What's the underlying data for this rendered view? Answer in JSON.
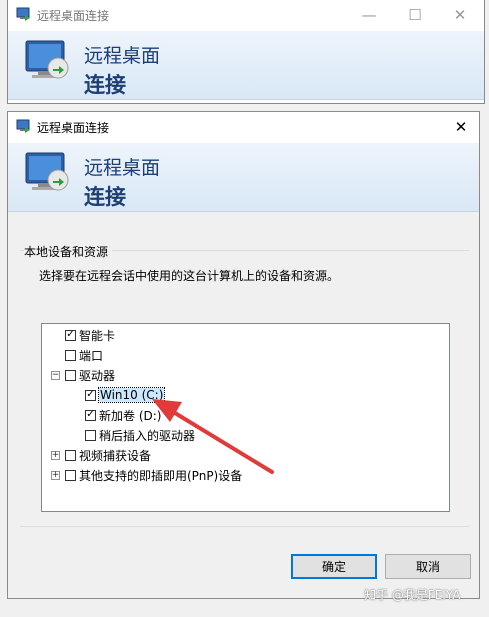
{
  "back_window": {
    "title": "远程桌面连接",
    "banner_line1": "远程桌面",
    "banner_line2": "连接",
    "minimize": "—",
    "maximize": "☐",
    "close": "✕"
  },
  "dialog": {
    "title": "远程桌面连接",
    "close": "✕",
    "banner_line1": "远程桌面",
    "banner_line2": "连接",
    "group_label": "本地设备和资源",
    "description": "选择要在远程会话中使用的这台计算机上的设备和资源。",
    "tree": {
      "smart_card": {
        "label": "智能卡",
        "checked": true
      },
      "ports": {
        "label": "端口",
        "checked": false
      },
      "drives": {
        "label": "驱动器",
        "checked": false,
        "expander": "−"
      },
      "drive_c": {
        "label": "Win10 (C:)",
        "checked": true
      },
      "drive_d": {
        "label": "新加卷 (D:)",
        "checked": true
      },
      "later_drives": {
        "label": "稍后插入的驱动器",
        "checked": false
      },
      "video": {
        "label": "视频捕获设备",
        "checked": false,
        "expander": "+"
      },
      "pnp": {
        "label": "其他支持的即插即用(PnP)设备",
        "checked": false,
        "expander": "+"
      }
    },
    "check_mark": "✓",
    "ok_label": "确定",
    "cancel_label": "取消"
  },
  "watermark": "知乎 @我是FEIYA",
  "colors": {
    "accent": "#0078d7",
    "banner_text": "#1b3f74",
    "arrow": "#e03a3a",
    "selection": "#cce8ff"
  }
}
